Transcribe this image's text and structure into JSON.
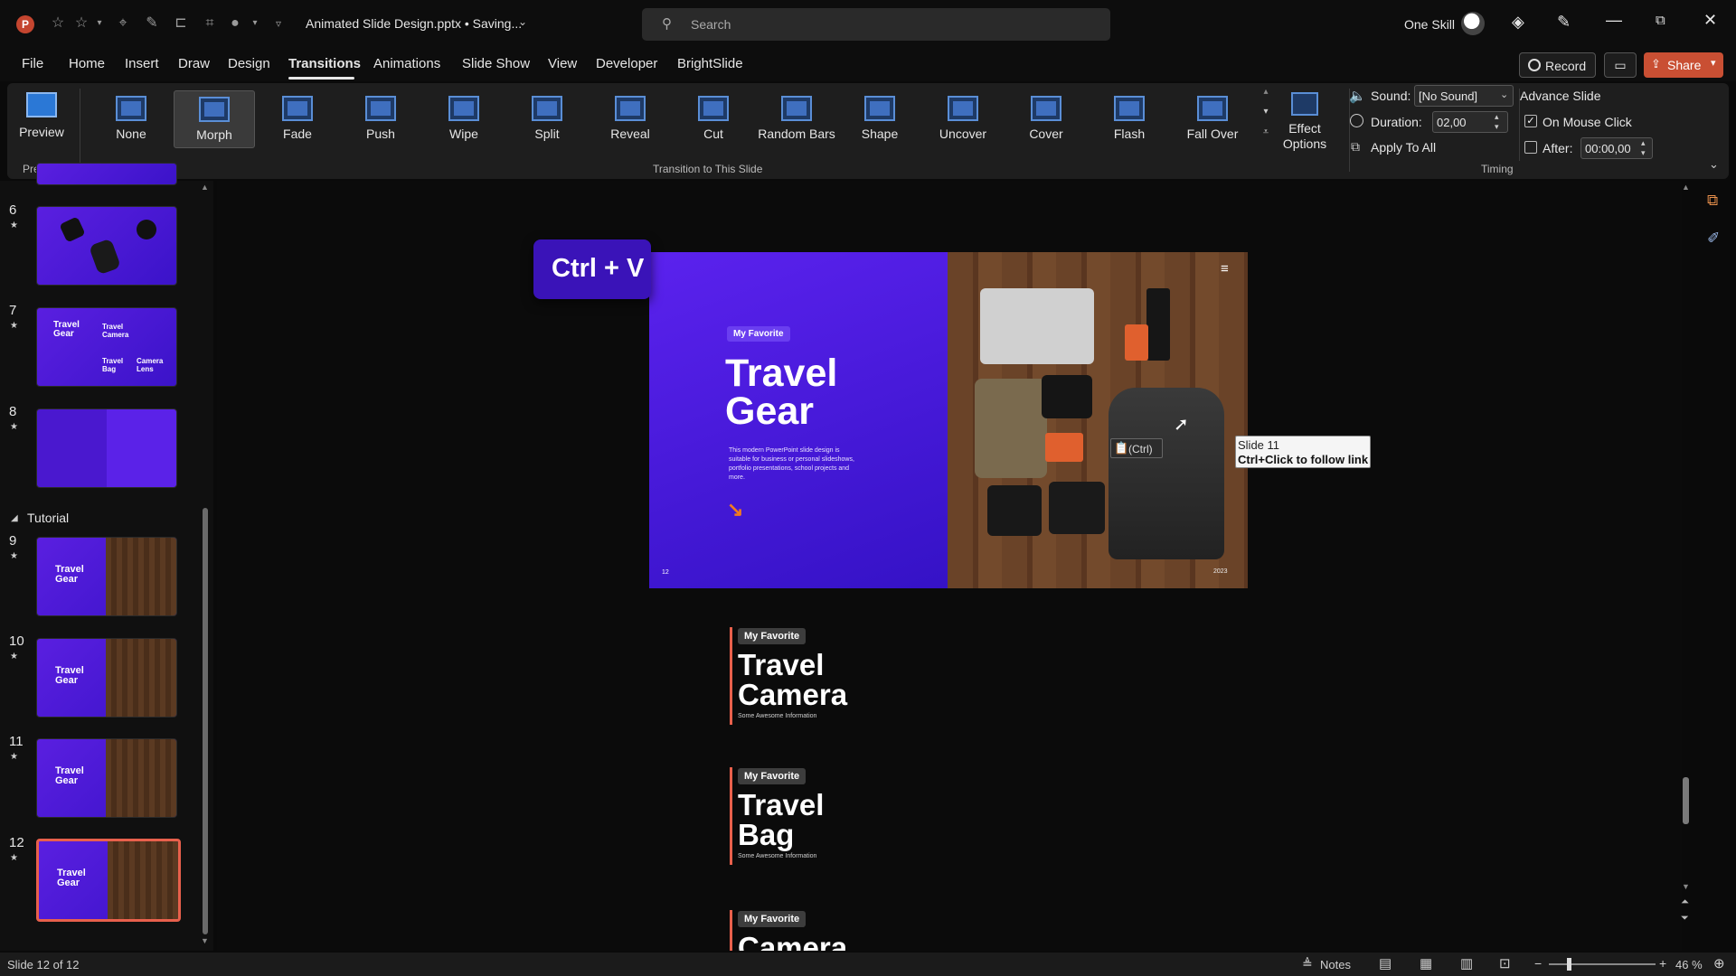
{
  "titlebar": {
    "filename": "Animated Slide Design.pptx • Saving...",
    "search_placeholder": "Search",
    "user_name": "One Skill"
  },
  "menu": [
    "File",
    "Home",
    "Insert",
    "Draw",
    "Design",
    "Transitions",
    "Animations",
    "Slide Show",
    "View",
    "Developer",
    "BrightSlide"
  ],
  "menu_active": "Transitions",
  "header_buttons": {
    "record": "Record",
    "share": "Share"
  },
  "ribbon": {
    "preview_label": "Preview",
    "preview_group": "Preview",
    "transitions": [
      "None",
      "Morph",
      "Fade",
      "Push",
      "Wipe",
      "Split",
      "Reveal",
      "Cut",
      "Random Bars",
      "Shape",
      "Uncover",
      "Cover",
      "Flash",
      "Fall Over"
    ],
    "selected_transition": "Morph",
    "transition_group": "Transition to This Slide",
    "effect_options": "Effect Options",
    "sound_label": "Sound:",
    "sound_value": "[No Sound]",
    "duration_label": "Duration:",
    "duration_value": "02,00",
    "apply_to_all": "Apply To All",
    "advance_slide": "Advance Slide",
    "on_mouse_click": "On Mouse Click",
    "after_label": "After:",
    "after_value": "00:00,00",
    "timing_group": "Timing"
  },
  "slides_panel": {
    "section_label": "Tutorial",
    "slides": [
      {
        "num": "6"
      },
      {
        "num": "7",
        "titles": [
          "Travel Gear",
          "Travel Camera",
          "Travel Bag",
          "Camera Lens"
        ]
      },
      {
        "num": "8"
      },
      {
        "num": "9",
        "title": "Travel Gear"
      },
      {
        "num": "10",
        "title": "Travel Gear"
      },
      {
        "num": "11",
        "title": "Travel Gear"
      },
      {
        "num": "12",
        "title": "Travel Gear"
      }
    ]
  },
  "slide": {
    "tag": "My Favorite",
    "title_line1": "Travel",
    "title_line2": "Gear",
    "body": "This modern PowerPoint slide design is suitable for business or personal slideshows, portfolio presentations, school projects and more.",
    "page_num": "12",
    "year": "2023"
  },
  "overlay": {
    "shortcut": "Ctrl + V",
    "paste_options": "(Ctrl)",
    "tooltip_line1": "Slide 11",
    "tooltip_line2": "Ctrl+Click to follow link"
  },
  "offslide_cards": [
    {
      "tag": "My Favorite",
      "line1": "Travel",
      "line2": "Camera",
      "sub": "Some Awesome Information"
    },
    {
      "tag": "My Favorite",
      "line1": "Travel",
      "line2": "Bag",
      "sub": "Some Awesome Information"
    },
    {
      "tag": "My Favorite",
      "line1": "Camera",
      "line2": "",
      "sub": ""
    }
  ],
  "statusbar": {
    "slide_info": "Slide 12 of 12",
    "notes": "Notes",
    "zoom": "46 %"
  },
  "colors": {
    "accent_purple": "#5b1fe6",
    "accent_orange": "#e8604c",
    "share_button": "#c94f33",
    "ribbon_bg": "#1e1e1e"
  }
}
